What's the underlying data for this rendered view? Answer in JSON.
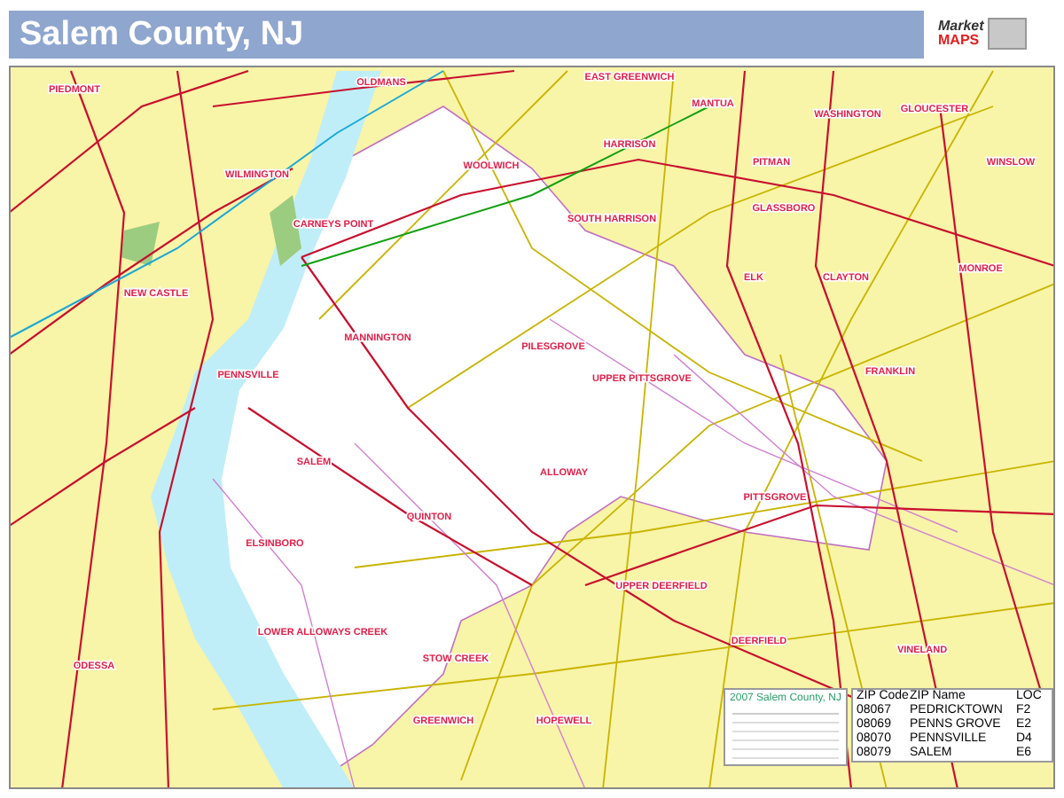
{
  "header": {
    "title": "Salem County, NJ"
  },
  "logo": {
    "word": "Market",
    "accent": "MAPS"
  },
  "map": {
    "places": [
      "PIEDMONT",
      "WILMINGTON",
      "NEW CASTLE",
      "OLDMANS",
      "CARNEYS POINT",
      "WOOLWICH",
      "PENNSVILLE",
      "MANNINGTON",
      "EAST GREENWICH",
      "MANTUA",
      "HARRISON",
      "SOUTH HARRISON",
      "PITMAN",
      "GLASSBORO",
      "WASHINGTON",
      "GLOUCESTER",
      "WINSLOW",
      "ELK",
      "CLAYTON",
      "MONROE",
      "FRANKLIN",
      "PILESGROVE",
      "UPPER PITTSGROVE",
      "SALEM",
      "ALLOWAY",
      "QUINTON",
      "ELSINBORO",
      "LOWER ALLOWAYS CREEK",
      "STOW CREEK",
      "PITTSGROVE",
      "UPPER DEERFIELD",
      "DEERFIELD",
      "VINELAND",
      "HOPEWELL",
      "GREENWICH",
      "ODESSA"
    ]
  },
  "legend": {
    "title": "2007 Salem County, NJ"
  },
  "zip_table": {
    "columns": [
      "ZIP Code",
      "ZIP Name",
      "LOC"
    ],
    "rows": [
      [
        "08067",
        "PEDRICKTOWN",
        "F2"
      ],
      [
        "08069",
        "PENNS GROVE",
        "E2"
      ],
      [
        "08070",
        "PENNSVILLE",
        "D4"
      ],
      [
        "08079",
        "SALEM",
        "E6"
      ]
    ]
  }
}
